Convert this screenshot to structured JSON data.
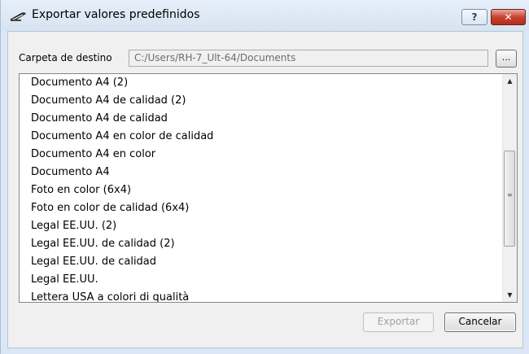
{
  "window": {
    "title": "Exportar valores predefinidos",
    "help_label": "?",
    "close_label": "✕"
  },
  "destination": {
    "label": "Carpeta de destino",
    "path": "C:/Users/RH-7_Ult-64/Documents",
    "browse_label": "..."
  },
  "presets": [
    "Documento A4 (2)",
    "Documento A4 de calidad (2)",
    "Documento A4 de calidad",
    "Documento A4 en color de calidad",
    "Documento A4 en color",
    "Documento A4",
    "Foto en color (6x4)",
    "Foto en color de calidad (6x4)",
    "Legal EE.UU. (2)",
    "Legal EE.UU. de calidad (2)",
    "Legal EE.UU. de calidad",
    "Legal EE.UU.",
    "Lettera USA a colori di qualità"
  ],
  "scrollbar": {
    "position_fraction": 0.35
  },
  "buttons": {
    "export_label": "Exportar",
    "export_enabled": false,
    "cancel_label": "Cancelar"
  },
  "colors": {
    "titlebar": "#dbe7f4",
    "close_button": "#c8432f",
    "dialog_background": "#f0f0f0"
  }
}
